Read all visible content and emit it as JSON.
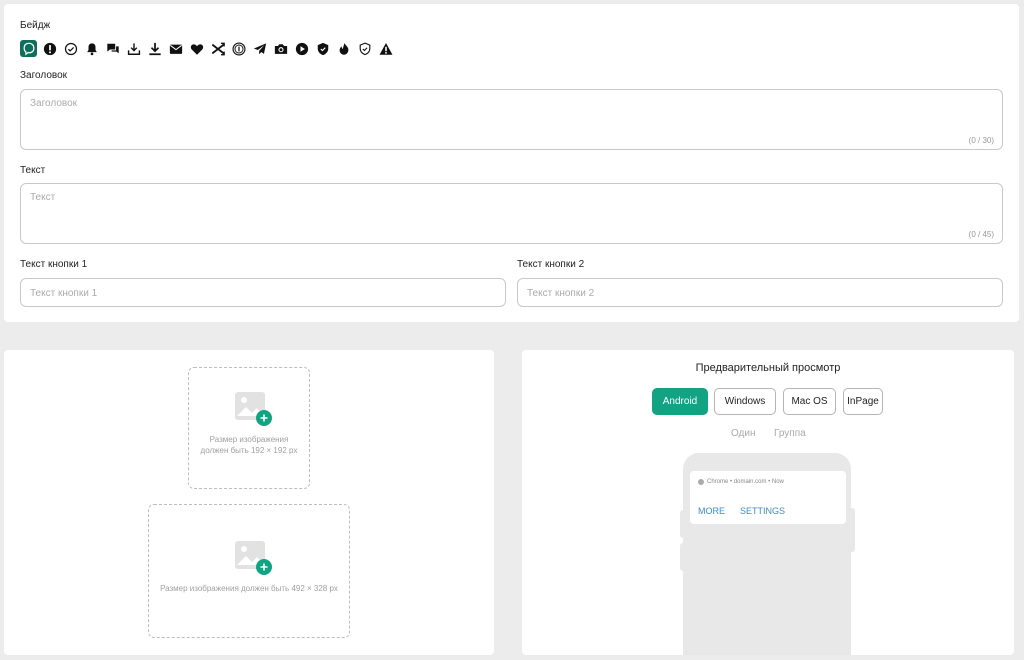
{
  "top": {
    "badge_label": "Бейдж",
    "badges": [
      "viber-icon",
      "alert-circle-icon",
      "check-circle-icon",
      "bell-icon",
      "chat-icon",
      "download-tray-icon",
      "download-icon",
      "mail-icon",
      "heart-icon",
      "shuffle-icon",
      "coin-icon",
      "telegram-icon",
      "camera-icon",
      "play-icon",
      "shield-icon",
      "fire-icon",
      "shield-check-icon",
      "warning-icon"
    ],
    "selected_badge": 0,
    "accent": "#0f6e5c",
    "title_label": "Заголовок",
    "title_placeholder": "Заголовок",
    "title_counter": "(0 / 30)",
    "text_label": "Текст",
    "text_placeholder": "Текст",
    "text_counter": "(0 / 45)",
    "btn1_label": "Текст кнопки 1",
    "btn1_placeholder": "Текст кнопки 1",
    "btn2_label": "Текст кнопки 2",
    "btn2_placeholder": "Текст кнопки 2"
  },
  "upload": {
    "icon_hint_small": "Размер изображения должен быть 192 × 192 px",
    "image_hint_large": "Размер изображения должен быть 492 × 328 px",
    "plus_color": "#12a383"
  },
  "preview": {
    "title": "Предварительный просмотр",
    "platforms": [
      "Android",
      "Windows",
      "Mac OS",
      "InPage"
    ],
    "active_platform": "Android",
    "modes": [
      "Один",
      "Группа"
    ],
    "notification_header": "Chrome • domain.com • Now",
    "actions": [
      "MORE",
      "SETTINGS"
    ]
  }
}
